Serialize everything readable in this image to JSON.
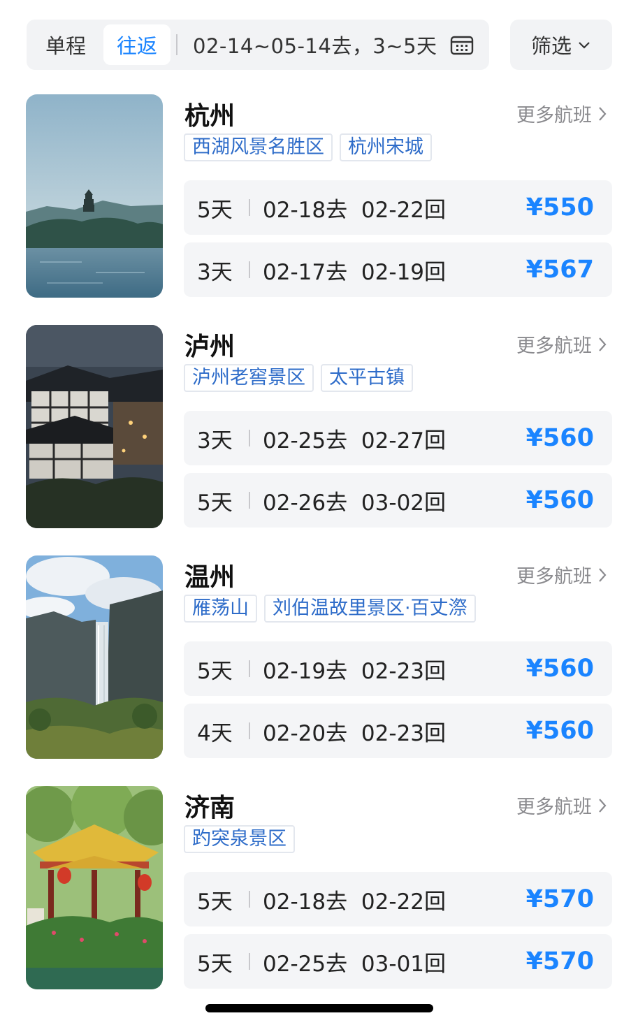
{
  "header": {
    "trip_types": [
      "单程",
      "往返"
    ],
    "selected_trip_type": "往返",
    "date_range_text": "02-14~05-14去，3~5天",
    "calendar_icon": "calendar-icon",
    "filter_label": "筛选",
    "filter_icon": "chevron-down-icon"
  },
  "more_flights_label": "更多航班",
  "destinations": [
    {
      "name": "杭州",
      "image": "west-lake-pagoda-photo",
      "tags": [
        "西湖风景名胜区",
        "杭州宋城"
      ],
      "offers": [
        {
          "days": "5天",
          "dates": "02-18去 02-22回",
          "price": "¥550"
        },
        {
          "days": "3天",
          "dates": "02-17去 02-19回",
          "price": "¥567"
        }
      ]
    },
    {
      "name": "泸州",
      "image": "old-town-night-photo",
      "tags": [
        "泸州老窖景区",
        "太平古镇"
      ],
      "offers": [
        {
          "days": "3天",
          "dates": "02-25去 02-27回",
          "price": "¥560"
        },
        {
          "days": "5天",
          "dates": "02-26去 03-02回",
          "price": "¥560"
        }
      ]
    },
    {
      "name": "温州",
      "image": "waterfall-cliff-photo",
      "tags": [
        "雁荡山",
        "刘伯温故里景区·百丈漈"
      ],
      "offers": [
        {
          "days": "5天",
          "dates": "02-19去 02-23回",
          "price": "¥560"
        },
        {
          "days": "4天",
          "dates": "02-20去 02-23回",
          "price": "¥560"
        }
      ]
    },
    {
      "name": "济南",
      "image": "baotu-spring-pavilion-photo",
      "tags": [
        "趵突泉景区"
      ],
      "offers": [
        {
          "days": "5天",
          "dates": "02-18去 02-22回",
          "price": "¥570"
        },
        {
          "days": "5天",
          "dates": "02-25去 03-01回",
          "price": "¥570"
        }
      ]
    }
  ],
  "colors": {
    "accent": "#1a84ff",
    "tag_text": "#2e6cc9",
    "row_bg": "#f4f5f7",
    "muted": "#8a8a8e"
  }
}
